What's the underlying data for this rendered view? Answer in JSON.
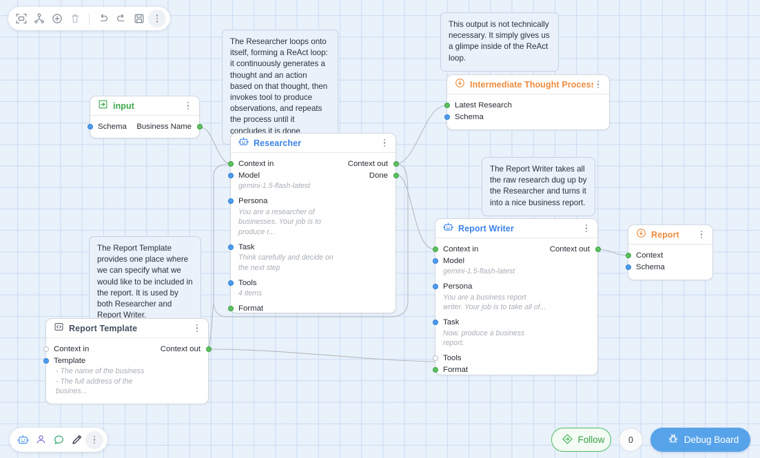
{
  "app": {
    "canvas_name": "flow-board"
  },
  "top_toolbar": {
    "items": [
      {
        "name": "fit-to-screen-icon",
        "label": "Fit to screen"
      },
      {
        "name": "auto-layout-icon",
        "label": "Auto layout"
      },
      {
        "name": "add-node-icon",
        "label": "Add node"
      },
      {
        "name": "delete-icon",
        "label": "Delete"
      },
      {
        "name": "undo-icon",
        "label": "Undo"
      },
      {
        "name": "redo-icon",
        "label": "Redo"
      },
      {
        "name": "save-icon",
        "label": "Save"
      },
      {
        "name": "more-options-icon",
        "label": "More"
      }
    ]
  },
  "bottom_toolbar": {
    "items": [
      {
        "name": "robot-icon",
        "label": "Agent"
      },
      {
        "name": "person-icon",
        "label": "Human"
      },
      {
        "name": "comment-icon",
        "label": "Comment"
      },
      {
        "name": "pen-icon",
        "label": "Draw"
      },
      {
        "name": "more-options-icon",
        "label": "More"
      }
    ]
  },
  "footer": {
    "follow_label": "Follow",
    "follow_icon": "follow-diamond-icon",
    "zoom_count": "0",
    "debug_label": "Debug Board",
    "debug_icon": "bug-icon"
  },
  "colors": {
    "accent_blue": "#3b82e8",
    "accent_green": "#3aa84a",
    "accent_orange": "#ef8b3c",
    "port_green": "#5cc25f",
    "port_blue": "#4e9cf0",
    "port_unconnected": "#ffffff",
    "canvas_bg": "#e9f1fb",
    "comment_bg": "#eaf1fa",
    "debug_button_bg": "#57a3ea"
  },
  "nodes": {
    "input": {
      "title": "input",
      "icon": "input-arrow-icon",
      "title_color": "green",
      "ports": [
        {
          "label": "Schema",
          "side": "left",
          "state": "blue"
        },
        {
          "label": "Business Name",
          "side": "right",
          "state": "green"
        }
      ]
    },
    "researcher": {
      "title": "Researcher",
      "icon": "robot-icon",
      "title_color": "blue",
      "rows": [
        {
          "label": "Context in",
          "right_label": "Context out",
          "left_port": "green",
          "right_port": "green"
        },
        {
          "label": "Model",
          "right_label": "Done",
          "left_port": "blue",
          "right_port": "green"
        },
        {
          "value": "gemini-1.5-flash-latest"
        },
        {
          "label": "Persona",
          "left_port": "blue"
        },
        {
          "value": "You are a researcher of"
        },
        {
          "value": "businesses. Your job is to"
        },
        {
          "value": "produce r..."
        },
        {
          "label": "Task",
          "left_port": "blue"
        },
        {
          "value": "Think carefully and decide on"
        },
        {
          "value": "the next step"
        },
        {
          "label": "Tools",
          "left_port": "blue"
        },
        {
          "value": "4 items"
        },
        {
          "label": "Format",
          "left_port": "green"
        }
      ]
    },
    "report_writer": {
      "title": "Report Writer",
      "icon": "robot-icon",
      "title_color": "blue",
      "rows": [
        {
          "label": "Context in",
          "right_label": "Context out",
          "left_port": "green",
          "right_port": "green"
        },
        {
          "label": "Model",
          "left_port": "blue"
        },
        {
          "value": "gemini-1.5-flash-latest"
        },
        {
          "label": "Persona",
          "left_port": "blue"
        },
        {
          "value": "You are a business report"
        },
        {
          "value": "writer. Your job is to take all of..."
        },
        {
          "label": "Task",
          "left_port": "blue"
        },
        {
          "value": "Now, produce a business"
        },
        {
          "value": "report."
        },
        {
          "label": "Tools",
          "left_port": "grey"
        },
        {
          "label": "Format",
          "left_port": "green"
        }
      ]
    },
    "report_template": {
      "title": "Report Template",
      "icon": "code-brackets-icon",
      "title_color": "grey",
      "rows": [
        {
          "label": "Context in",
          "right_label": "Context out",
          "left_port": "grey",
          "right_port": "green"
        },
        {
          "label": "Template",
          "left_port": "blue"
        },
        {
          "value": "- The name of the business"
        },
        {
          "value": "- The full address of the"
        },
        {
          "value": "busines..."
        }
      ]
    },
    "intermediate_thought_process": {
      "title": "Intermediate Thought Process",
      "icon": "output-arrow-icon",
      "title_color": "orange",
      "ports": [
        {
          "label": "Latest Research",
          "side": "left",
          "state": "green"
        },
        {
          "label": "Schema",
          "side": "left",
          "state": "blue"
        }
      ]
    },
    "report": {
      "title": "Report",
      "icon": "output-arrow-icon",
      "title_color": "orange",
      "ports": [
        {
          "label": "Context",
          "side": "left",
          "state": "green"
        },
        {
          "label": "Schema",
          "side": "left",
          "state": "blue"
        }
      ]
    }
  },
  "comments": {
    "researcher_loop": "The Researcher loops onto itself, forming a ReAct loop: it continuously generates a thought and an action based on that thought, then invokes tool to produce observations, and repeats the process until it concludes it is done.",
    "intermediate_output": "This output is not technically necessary. It simply gives us a glimpe inside of the ReAct loop.",
    "report_writer_note": "The Report Writer takes all the raw research dug up by the Researcher and turns it into a nice business report.",
    "report_template_note": "The Report Template provides one place where we can specify what we would like to be included in the report. It is used by both Researcher and Report Writer."
  }
}
